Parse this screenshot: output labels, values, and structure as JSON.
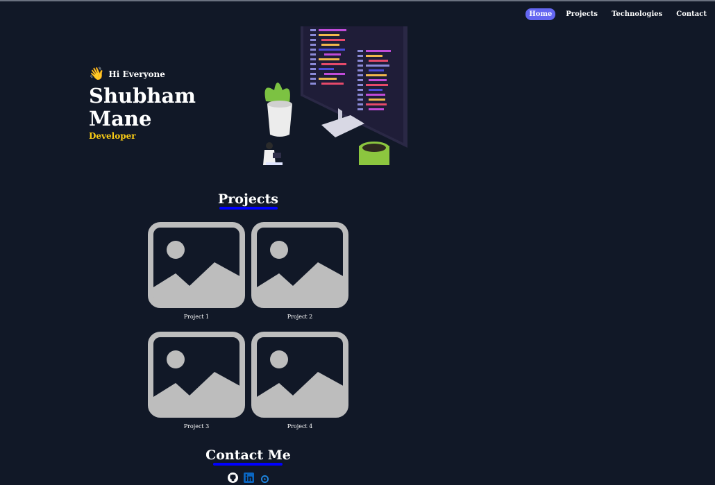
{
  "nav": {
    "items": [
      {
        "label": "Home",
        "active": true
      },
      {
        "label": "Projects",
        "active": false
      },
      {
        "label": "Technologies",
        "active": false
      },
      {
        "label": "Contact",
        "active": false
      }
    ]
  },
  "hero": {
    "greeting": "Hi Everyone",
    "greeting_icon": "waving-hand-icon",
    "name": "Shubham Mane",
    "role": "Developer",
    "illustration": "developer-desk-illustration"
  },
  "projects": {
    "title": "Projects",
    "items": [
      {
        "caption": "Project 1",
        "icon": "image-placeholder-icon"
      },
      {
        "caption": "Project 2",
        "icon": "image-placeholder-icon"
      },
      {
        "caption": "Project 3",
        "icon": "image-placeholder-icon"
      },
      {
        "caption": "Project 4",
        "icon": "image-placeholder-icon"
      }
    ]
  },
  "contact": {
    "title": "Contact Me",
    "links": [
      "github-icon",
      "linkedin-icon",
      "play-circle-icon"
    ]
  },
  "colors": {
    "background": "#111827",
    "accent": "#6366f1",
    "role": "#facc15",
    "underline": "#0000ff",
    "placeholder": "#bdbdbd"
  }
}
